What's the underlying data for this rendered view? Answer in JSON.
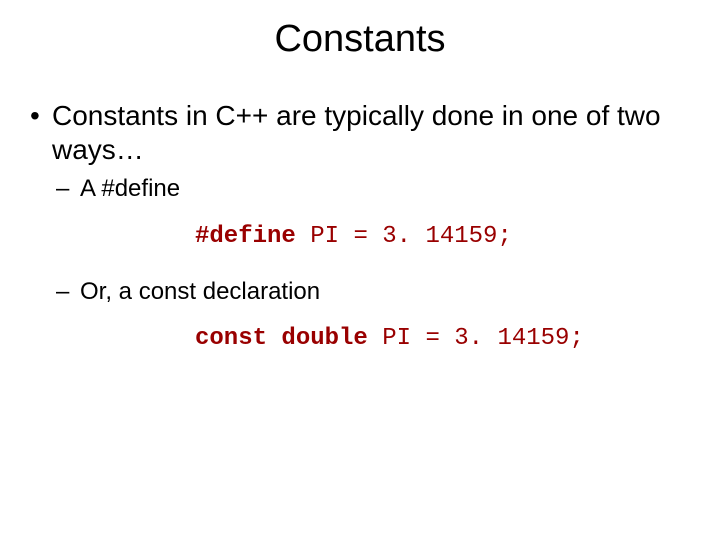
{
  "title": "Constants",
  "bullet1": "Constants in C++ are typically done in one of two ways…",
  "sub1": "A #define",
  "code1_kw": "#define",
  "code1_rest": " PI = 3. 14159;",
  "sub2": "Or, a const declaration",
  "code2_kw": "const double",
  "code2_rest": " PI = 3. 14159;"
}
